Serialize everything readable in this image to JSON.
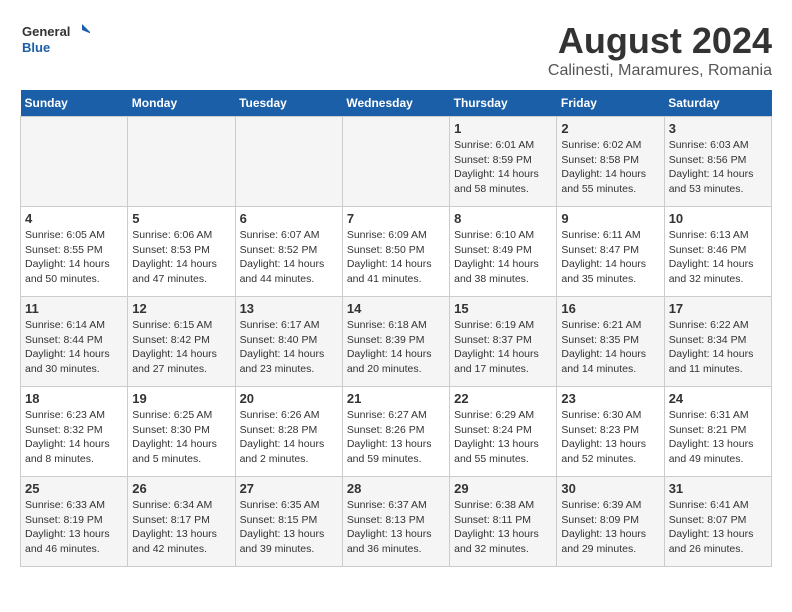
{
  "header": {
    "logo_line1": "General",
    "logo_line2": "Blue",
    "title": "August 2024",
    "subtitle": "Calinesti, Maramures, Romania"
  },
  "days_of_week": [
    "Sunday",
    "Monday",
    "Tuesday",
    "Wednesday",
    "Thursday",
    "Friday",
    "Saturday"
  ],
  "weeks": [
    [
      {
        "day": "",
        "content": ""
      },
      {
        "day": "",
        "content": ""
      },
      {
        "day": "",
        "content": ""
      },
      {
        "day": "",
        "content": ""
      },
      {
        "day": "1",
        "content": "Sunrise: 6:01 AM\nSunset: 8:59 PM\nDaylight: 14 hours\nand 58 minutes."
      },
      {
        "day": "2",
        "content": "Sunrise: 6:02 AM\nSunset: 8:58 PM\nDaylight: 14 hours\nand 55 minutes."
      },
      {
        "day": "3",
        "content": "Sunrise: 6:03 AM\nSunset: 8:56 PM\nDaylight: 14 hours\nand 53 minutes."
      }
    ],
    [
      {
        "day": "4",
        "content": "Sunrise: 6:05 AM\nSunset: 8:55 PM\nDaylight: 14 hours\nand 50 minutes."
      },
      {
        "day": "5",
        "content": "Sunrise: 6:06 AM\nSunset: 8:53 PM\nDaylight: 14 hours\nand 47 minutes."
      },
      {
        "day": "6",
        "content": "Sunrise: 6:07 AM\nSunset: 8:52 PM\nDaylight: 14 hours\nand 44 minutes."
      },
      {
        "day": "7",
        "content": "Sunrise: 6:09 AM\nSunset: 8:50 PM\nDaylight: 14 hours\nand 41 minutes."
      },
      {
        "day": "8",
        "content": "Sunrise: 6:10 AM\nSunset: 8:49 PM\nDaylight: 14 hours\nand 38 minutes."
      },
      {
        "day": "9",
        "content": "Sunrise: 6:11 AM\nSunset: 8:47 PM\nDaylight: 14 hours\nand 35 minutes."
      },
      {
        "day": "10",
        "content": "Sunrise: 6:13 AM\nSunset: 8:46 PM\nDaylight: 14 hours\nand 32 minutes."
      }
    ],
    [
      {
        "day": "11",
        "content": "Sunrise: 6:14 AM\nSunset: 8:44 PM\nDaylight: 14 hours\nand 30 minutes."
      },
      {
        "day": "12",
        "content": "Sunrise: 6:15 AM\nSunset: 8:42 PM\nDaylight: 14 hours\nand 27 minutes."
      },
      {
        "day": "13",
        "content": "Sunrise: 6:17 AM\nSunset: 8:40 PM\nDaylight: 14 hours\nand 23 minutes."
      },
      {
        "day": "14",
        "content": "Sunrise: 6:18 AM\nSunset: 8:39 PM\nDaylight: 14 hours\nand 20 minutes."
      },
      {
        "day": "15",
        "content": "Sunrise: 6:19 AM\nSunset: 8:37 PM\nDaylight: 14 hours\nand 17 minutes."
      },
      {
        "day": "16",
        "content": "Sunrise: 6:21 AM\nSunset: 8:35 PM\nDaylight: 14 hours\nand 14 minutes."
      },
      {
        "day": "17",
        "content": "Sunrise: 6:22 AM\nSunset: 8:34 PM\nDaylight: 14 hours\nand 11 minutes."
      }
    ],
    [
      {
        "day": "18",
        "content": "Sunrise: 6:23 AM\nSunset: 8:32 PM\nDaylight: 14 hours\nand 8 minutes."
      },
      {
        "day": "19",
        "content": "Sunrise: 6:25 AM\nSunset: 8:30 PM\nDaylight: 14 hours\nand 5 minutes."
      },
      {
        "day": "20",
        "content": "Sunrise: 6:26 AM\nSunset: 8:28 PM\nDaylight: 14 hours\nand 2 minutes."
      },
      {
        "day": "21",
        "content": "Sunrise: 6:27 AM\nSunset: 8:26 PM\nDaylight: 13 hours\nand 59 minutes."
      },
      {
        "day": "22",
        "content": "Sunrise: 6:29 AM\nSunset: 8:24 PM\nDaylight: 13 hours\nand 55 minutes."
      },
      {
        "day": "23",
        "content": "Sunrise: 6:30 AM\nSunset: 8:23 PM\nDaylight: 13 hours\nand 52 minutes."
      },
      {
        "day": "24",
        "content": "Sunrise: 6:31 AM\nSunset: 8:21 PM\nDaylight: 13 hours\nand 49 minutes."
      }
    ],
    [
      {
        "day": "25",
        "content": "Sunrise: 6:33 AM\nSunset: 8:19 PM\nDaylight: 13 hours\nand 46 minutes."
      },
      {
        "day": "26",
        "content": "Sunrise: 6:34 AM\nSunset: 8:17 PM\nDaylight: 13 hours\nand 42 minutes."
      },
      {
        "day": "27",
        "content": "Sunrise: 6:35 AM\nSunset: 8:15 PM\nDaylight: 13 hours\nand 39 minutes."
      },
      {
        "day": "28",
        "content": "Sunrise: 6:37 AM\nSunset: 8:13 PM\nDaylight: 13 hours\nand 36 minutes."
      },
      {
        "day": "29",
        "content": "Sunrise: 6:38 AM\nSunset: 8:11 PM\nDaylight: 13 hours\nand 32 minutes."
      },
      {
        "day": "30",
        "content": "Sunrise: 6:39 AM\nSunset: 8:09 PM\nDaylight: 13 hours\nand 29 minutes."
      },
      {
        "day": "31",
        "content": "Sunrise: 6:41 AM\nSunset: 8:07 PM\nDaylight: 13 hours\nand 26 minutes."
      }
    ]
  ]
}
